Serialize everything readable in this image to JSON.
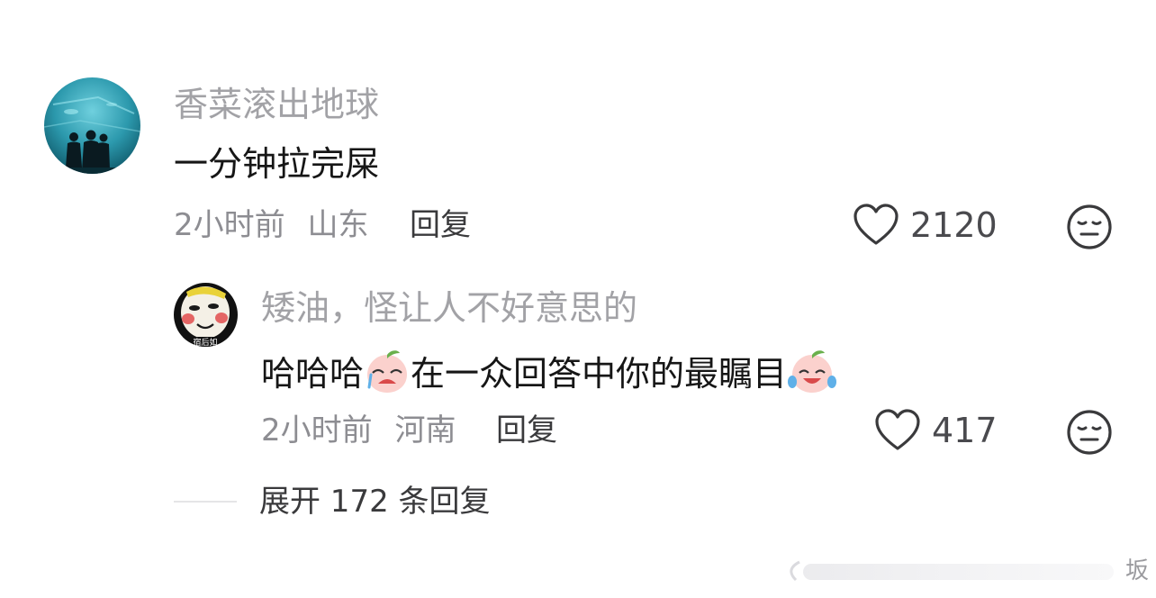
{
  "comment": {
    "username": "香菜滚出地球",
    "text": "一分钟拉完屎",
    "time": "2小时前",
    "location": "山东",
    "reply_label": "回复",
    "likes": "2120",
    "icons": {
      "like": "heart-outline-icon",
      "dislike": "meh-face-icon"
    }
  },
  "reply": {
    "username": "矮油，怪让人不好意思的",
    "text_part1": "哈哈哈",
    "text_part2": "在一众回答中你的最瞩目",
    "time": "2小时前",
    "location": "河南",
    "reply_label": "回复",
    "likes": "417",
    "avatar_caption": "宿后如",
    "emojis": [
      "crying-peach-emoji",
      "laugh-cry-peach-emoji"
    ]
  },
  "expand": {
    "label": "展开 172 条回复"
  },
  "watermark": {
    "text": "坂"
  },
  "colors": {
    "username": "#a2a2a6",
    "comment_text": "#161616",
    "meta": "#8d8d92",
    "icon_stroke": "#3a3a3c"
  }
}
